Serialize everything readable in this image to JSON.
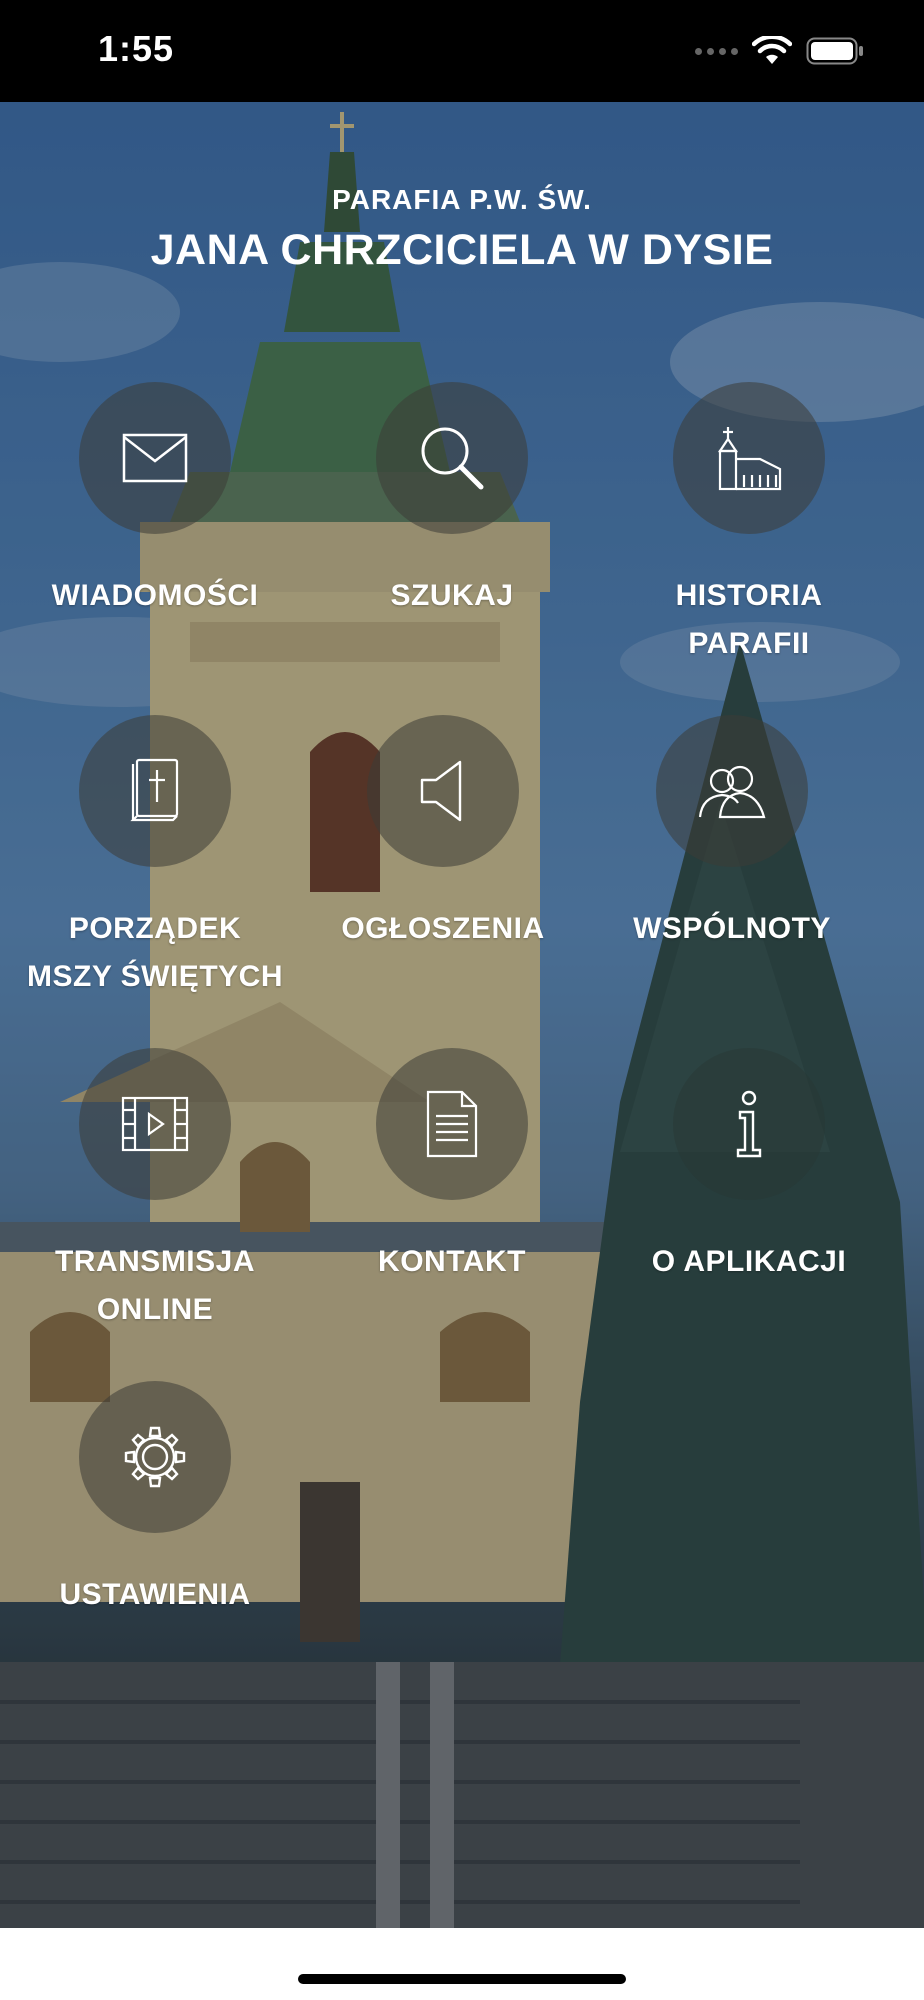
{
  "status_bar": {
    "time": "1:55"
  },
  "header": {
    "subtitle": "PARAFIA P.W. ŚW.",
    "title": "JANA CHRZCICIELA W DYSIE"
  },
  "menu": [
    {
      "label": "WIADOMOŚCI",
      "icon": "envelope-icon"
    },
    {
      "label": "SZUKAJ",
      "icon": "search-icon"
    },
    {
      "label": "HISTORIA\nPARAFII",
      "icon": "church-icon"
    },
    {
      "label": "PORZĄDEK\nMSZY ŚWIĘTYCH",
      "icon": "bible-icon"
    },
    {
      "label": "OGŁOSZENIA",
      "icon": "speaker-icon"
    },
    {
      "label": "WSPÓLNOTY",
      "icon": "people-icon"
    },
    {
      "label": "TRANSMISJA\nONLINE",
      "icon": "video-icon"
    },
    {
      "label": "KONTAKT",
      "icon": "document-icon"
    },
    {
      "label": "O APLIKACJI",
      "icon": "info-icon"
    },
    {
      "label": "USTAWIENIA",
      "icon": "gear-icon"
    }
  ],
  "colors": {
    "status_bar_bg": "#000000",
    "tile_circle": "#3c3c37",
    "text": "#ffffff"
  }
}
